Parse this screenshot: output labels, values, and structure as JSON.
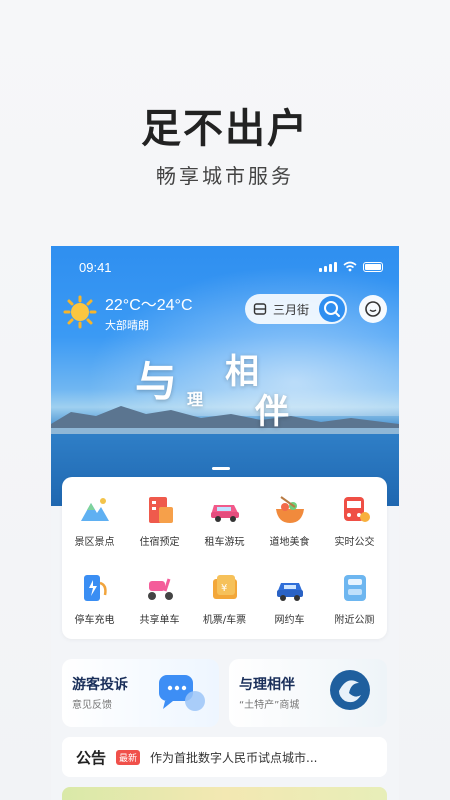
{
  "headline": "足不出户",
  "subline": "畅享城市服务",
  "status": {
    "time": "09:41"
  },
  "weather": {
    "temp": "22°C～24°C",
    "desc": "大部晴朗"
  },
  "search": {
    "label": "三月街"
  },
  "slogan": {
    "line1": "与",
    "small": "理",
    "line2": "相",
    "line3": "伴"
  },
  "banner": {
    "slides": 3,
    "active_slide": 1
  },
  "services": [
    {
      "label": "景区景点",
      "icon": "mountain-icon"
    },
    {
      "label": "住宿预定",
      "icon": "hotel-icon"
    },
    {
      "label": "租车游玩",
      "icon": "car-rental-icon"
    },
    {
      "label": "道地美食",
      "icon": "food-bowl-icon"
    },
    {
      "label": "实时公交",
      "icon": "bus-icon"
    },
    {
      "label": "停车充电",
      "icon": "charging-icon"
    },
    {
      "label": "共享单车",
      "icon": "scooter-icon"
    },
    {
      "label": "机票/车票",
      "icon": "ticket-icon"
    },
    {
      "label": "网约车",
      "icon": "taxi-icon"
    },
    {
      "label": "附近公厕",
      "icon": "toilet-icon"
    }
  ],
  "promo_left": {
    "title": "游客投诉",
    "subtitle": "意见反馈"
  },
  "promo_right": {
    "title": "与理相伴",
    "subtitle": "“土特产”商城"
  },
  "notice": {
    "title": "公告",
    "badge": "最新",
    "text": "作为首批数字人民币试点城市..."
  },
  "colors": {
    "accent": "#2f8ff0",
    "badge": "#f0504a"
  }
}
